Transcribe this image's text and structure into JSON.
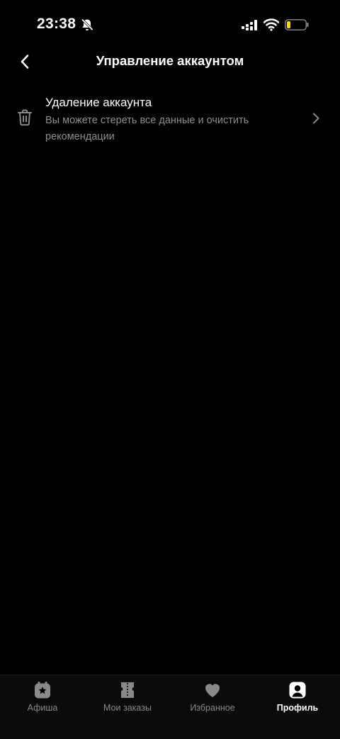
{
  "status_bar": {
    "time": "23:38",
    "icons": [
      "bell-off-icon",
      "signal-icon",
      "wifi-icon",
      "battery-low-icon"
    ],
    "battery_color": "#f5d90a"
  },
  "header": {
    "title": "Управление аккаунтом",
    "back_icon": "chevron-left-icon"
  },
  "settings": {
    "items": [
      {
        "icon": "trash-icon",
        "title": "Удаление аккаунта",
        "description": "Вы можете стереть все данные и очистить рекомендации",
        "chevron": "chevron-right-icon"
      }
    ]
  },
  "bottom_nav": {
    "items": [
      {
        "label": "Афиша",
        "icon": "poster-star-icon",
        "active": false
      },
      {
        "label": "Мои заказы",
        "icon": "tickets-icon",
        "active": false
      },
      {
        "label": "Избранное",
        "icon": "heart-icon",
        "active": false
      },
      {
        "label": "Профиль",
        "icon": "profile-icon",
        "active": true
      }
    ]
  },
  "colors": {
    "background": "#000000",
    "text_primary": "#ffffff",
    "text_secondary": "#8f8f8f",
    "nav_inactive": "#8a8a8a"
  }
}
